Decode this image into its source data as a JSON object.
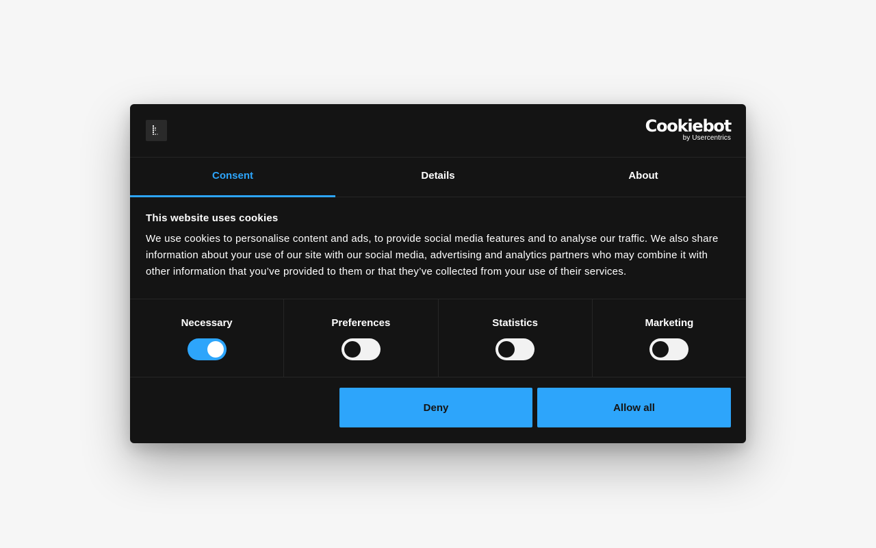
{
  "brand": {
    "name": "Cookiebot",
    "sub": "by Usercentrics"
  },
  "tabs": [
    {
      "label": "Consent",
      "active": true
    },
    {
      "label": "Details",
      "active": false
    },
    {
      "label": "About",
      "active": false
    }
  ],
  "consent": {
    "title": "This website uses cookies",
    "description": "We use cookies to personalise content and ads, to provide social media features and to analyse our traffic. We also share information about your use of our site with our social media, advertising and analytics partners who may combine it with other information that you’ve provided to them or that they’ve collected from your use of their services."
  },
  "toggles": [
    {
      "label": "Necessary",
      "checked": true
    },
    {
      "label": "Preferences",
      "checked": false
    },
    {
      "label": "Statistics",
      "checked": false
    },
    {
      "label": "Marketing",
      "checked": false
    }
  ],
  "buttons": {
    "deny": "Deny",
    "allow_all": "Allow all"
  },
  "colors": {
    "accent": "#2da5fb",
    "dialog_bg": "#141414",
    "page_bg": "#f6f6f6"
  }
}
